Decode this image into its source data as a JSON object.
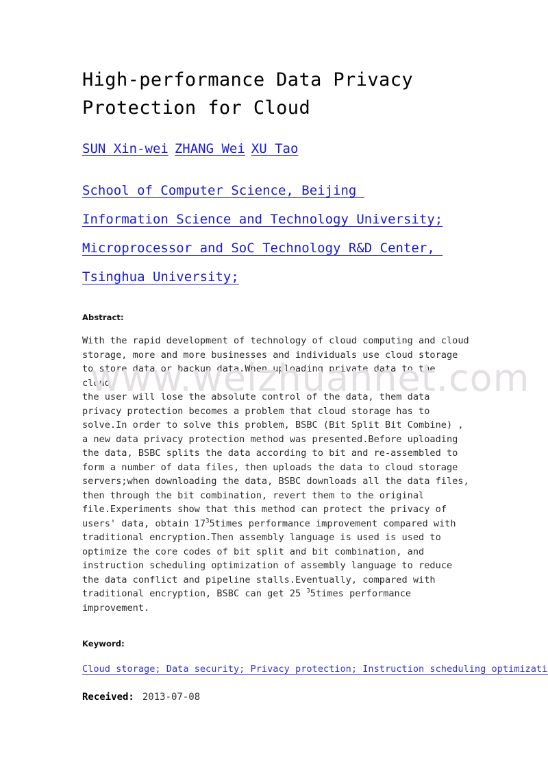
{
  "document": {
    "title": "High-performance Data Privacy Protection for Cloud",
    "title_lines": [
      "High-performance Data Privacy",
      "Protection for Cloud"
    ],
    "authors": [
      {
        "name": "SUN Xin-wei"
      },
      {
        "name": "ZHANG Wei"
      },
      {
        "name": "XU Tao"
      }
    ],
    "affiliation_lines": [
      "School of Computer Science, Beijing ",
      "Information Science and Technology University;",
      "Microprocessor and SoC Technology R&D Center, ",
      "Tsinghua University;"
    ],
    "abstract": {
      "label": "Abstract:",
      "text_part1": "With the rapid development of technology of cloud computing and cloud\nstorage, more and more businesses and individuals use cloud storage\nto store data or backup data.When uploading private data to the cloud,\nthe user will lose the absolute control of the data, them data\nprivacy protection becomes a problem that cloud storage has to\nsolve.In order to solve this problem, BSBC (Bit Split Bit Combine) ,\na new data privacy protection method was presented.Before uploading\nthe data, BSBC splits the data according to bit and re-assembled to\nform a number of data files, then uploads the data to cloud storage\nservers;when downloading the data, BSBC downloads all the data files,\nthen through the bit combination, revert them to the original\nfile.Experiments show that this method can protect the privacy of\nusers' data, obtain 17",
      "sup1": "3",
      "text_part2": "5times performance improvement compared with\ntraditional encryption.Then assembly language is used is used to\noptimize the core codes of bit split and bit combination, and\ninstruction scheduling optimization of assembly language to reduce\nthe data conflict and pipeline stalls.Eventually, compared with\ntraditional encryption, BSBC can get 25 ",
      "sup2": "3",
      "text_part3": "5times performance\nimprovement."
    },
    "keywords": {
      "label": "Keyword:",
      "items": [
        "Cloud storage; ",
        "Data security; ",
        "Privacy protection; ",
        "Instruction scheduling optimization;"
      ]
    },
    "received": {
      "label": "Received:",
      "date": "2013-07-08"
    },
    "watermark": {
      "text": "www.weizhuannet.com"
    },
    "colors": {
      "link_blue": "#1a1ad0",
      "keyword_blue": "#3333cc",
      "body_text": "#2b2b2b",
      "title_text": "#000000",
      "watermark_gray": "#e3dfe3",
      "page_background": "#ffffff"
    }
  }
}
